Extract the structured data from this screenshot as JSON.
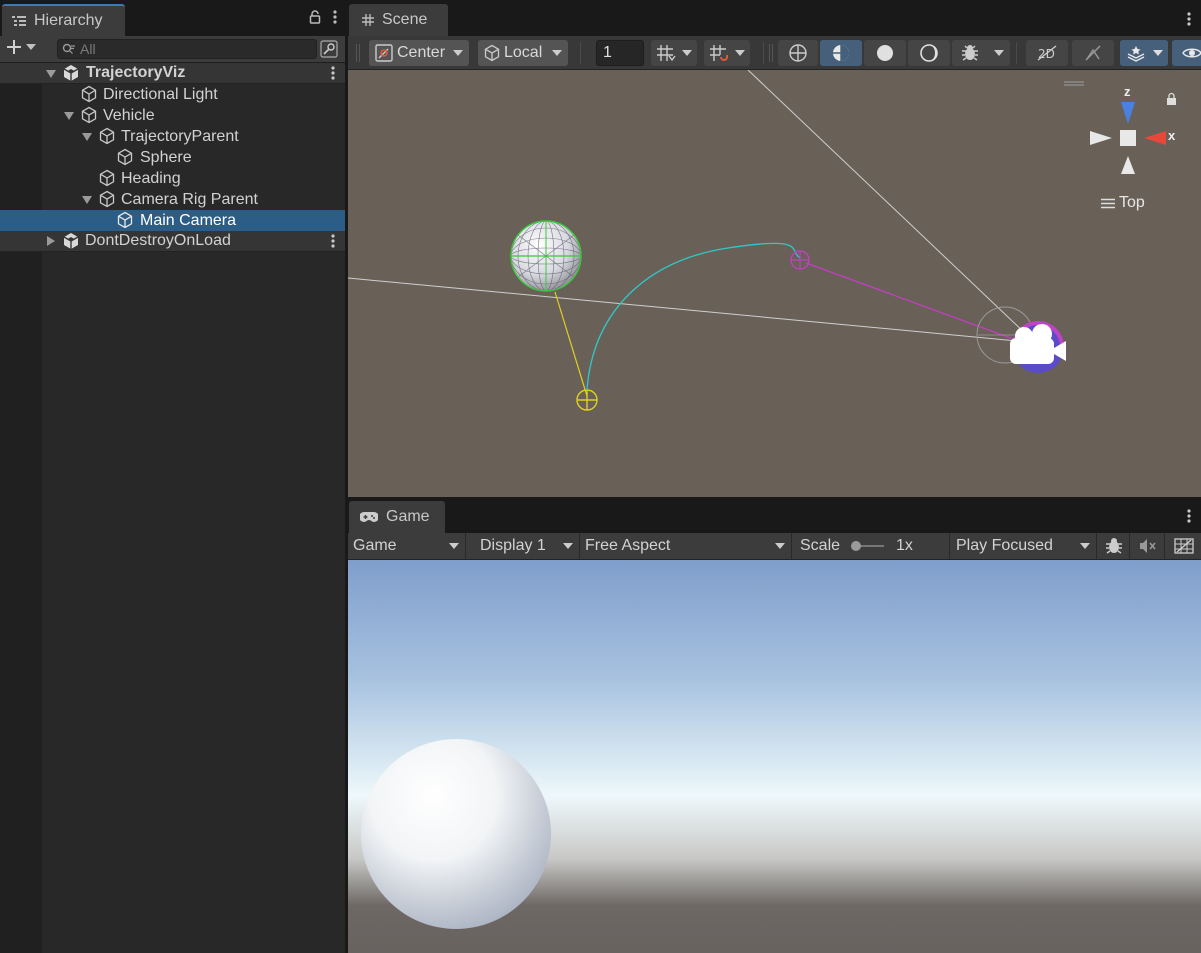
{
  "hierarchy": {
    "tab_title": "Hierarchy",
    "search_placeholder": "All",
    "items": [
      {
        "label": "TrajectoryViz",
        "depth": 0,
        "expanded": true,
        "kind": "scene"
      },
      {
        "label": "Directional Light",
        "depth": 1,
        "kind": "object"
      },
      {
        "label": "Vehicle",
        "depth": 1,
        "expanded": true,
        "kind": "object"
      },
      {
        "label": "TrajectoryParent",
        "depth": 2,
        "expanded": true,
        "kind": "object"
      },
      {
        "label": "Sphere",
        "depth": 3,
        "kind": "object"
      },
      {
        "label": "Heading",
        "depth": 2,
        "kind": "object"
      },
      {
        "label": "Camera Rig Parent",
        "depth": 2,
        "expanded": true,
        "kind": "object"
      },
      {
        "label": "Main Camera",
        "depth": 3,
        "kind": "object",
        "selected": true
      },
      {
        "label": "DontDestroyOnLoad",
        "depth": 0,
        "expanded": false,
        "kind": "scene"
      }
    ]
  },
  "scene": {
    "tab_title": "Scene",
    "toolbar": {
      "pivot_label": "Center",
      "space_label": "Local",
      "grid_snap_value": "1"
    },
    "gizmo": {
      "axis_z": "z",
      "axis_x": "x",
      "view_label": "Top"
    }
  },
  "game": {
    "tab_title": "Game",
    "toolbar": {
      "mode_label": "Game",
      "display_label": "Display 1",
      "aspect_label": "Free Aspect",
      "scale_label": "Scale",
      "scale_value": "1x",
      "play_mode_label": "Play Focused"
    }
  },
  "colors": {
    "selection": "#2c5d87",
    "accent_tab": "#3a79bb",
    "scene_bg": "#696158",
    "trajectory": "#2ec9c9",
    "heading": "#c040c0",
    "sphere_link": "#e0d020",
    "gizmo_x": "#e8483a",
    "gizmo_z": "#4a80e0"
  }
}
